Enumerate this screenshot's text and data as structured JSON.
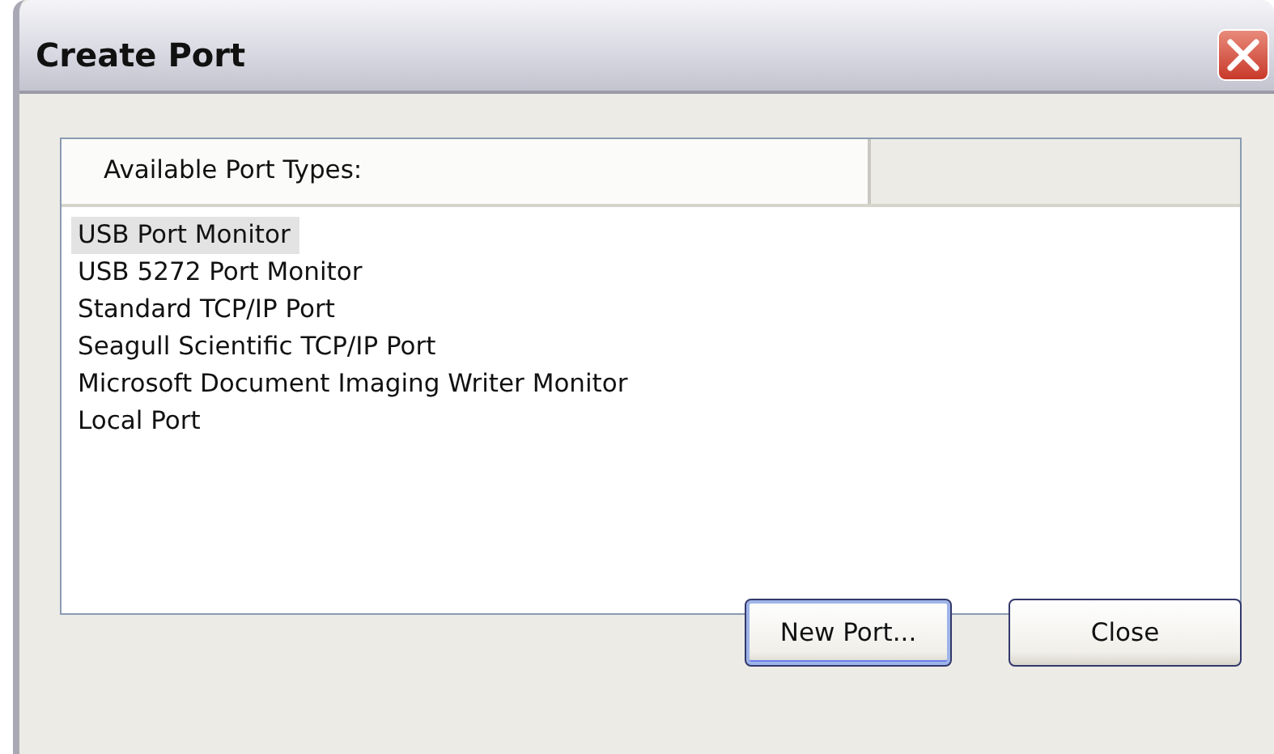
{
  "window": {
    "title": "Create Port"
  },
  "list": {
    "columns": [
      "Available Port Types:"
    ],
    "items": [
      {
        "label": "USB Port Monitor",
        "selected": true
      },
      {
        "label": "USB 5272 Port Monitor",
        "selected": false
      },
      {
        "label": "Standard TCP/IP Port",
        "selected": false
      },
      {
        "label": "Seagull Scientific TCP/IP Port",
        "selected": false
      },
      {
        "label": "Microsoft Document Imaging Writer Monitor",
        "selected": false
      },
      {
        "label": "Local Port",
        "selected": false
      }
    ]
  },
  "buttons": [
    {
      "label": "New Port...",
      "default": true
    },
    {
      "label": "Close",
      "default": false
    }
  ]
}
